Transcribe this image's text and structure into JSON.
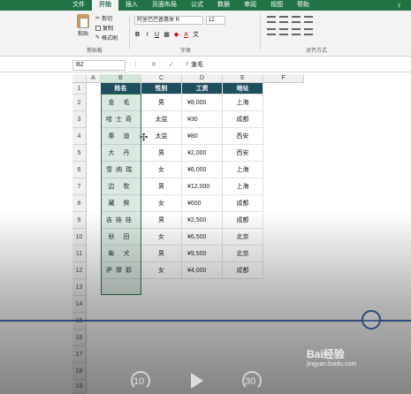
{
  "ribbon": {
    "tabs": [
      "文件",
      "开始",
      "插入",
      "页面布局",
      "公式",
      "数据",
      "审阅",
      "视图",
      "帮助"
    ],
    "active_tab": "开始",
    "clipboard": {
      "paste": "粘贴",
      "cut": "剪切",
      "copy": "复制",
      "format_painter": "格式刷",
      "group_label": "剪贴板"
    },
    "font": {
      "family": "阿里巴巴普惠体 R",
      "size": "12",
      "bold": "B",
      "italic": "I",
      "underline": "U",
      "grow": "A",
      "shrink": "A",
      "group_label": "字体"
    },
    "alignment": {
      "group_label": "对齐方式"
    }
  },
  "formula_bar": {
    "name_box": "B2",
    "controls": "⋮ ✕ ✓ fx",
    "value": "金毛"
  },
  "columns": [
    "A",
    "B",
    "C",
    "D",
    "E",
    "F"
  ],
  "rows": [
    "1",
    "2",
    "3",
    "4",
    "5",
    "6",
    "7",
    "8",
    "9",
    "10",
    "11",
    "12",
    "13",
    "14",
    "15",
    "16",
    "17",
    "18",
    "19"
  ],
  "table": {
    "headers": [
      "姓名",
      "性别",
      "工资",
      "地址"
    ],
    "rows": [
      [
        "金 毛",
        "男",
        "¥8,000",
        "上海"
      ],
      [
        "哈士奇",
        "太监",
        "¥30",
        "成都"
      ],
      [
        "秦 迪",
        "太监",
        "¥80",
        "西安"
      ],
      [
        "大 丹",
        "男",
        "¥2,000",
        "西安"
      ],
      [
        "雪纳瑞",
        "女",
        "¥6,000",
        "上海"
      ],
      [
        "边 牧",
        "男",
        "¥12,000",
        "上海"
      ],
      [
        "藏 獒",
        "女",
        "¥600",
        "成都"
      ],
      [
        "吉娃娃",
        "男",
        "¥2,500",
        "成都"
      ],
      [
        "秋 田",
        "女",
        "¥6,500",
        "北京"
      ],
      [
        "柴 犬",
        "男",
        "¥9,500",
        "北京"
      ],
      [
        "萨摩耶",
        "女",
        "¥4,000",
        "成都"
      ]
    ]
  },
  "video": {
    "skip_back": "10",
    "skip_forward": "30",
    "progress": 0.9
  },
  "watermark": {
    "text": "Bai经验",
    "sub": "jingyan.baidu.com"
  }
}
